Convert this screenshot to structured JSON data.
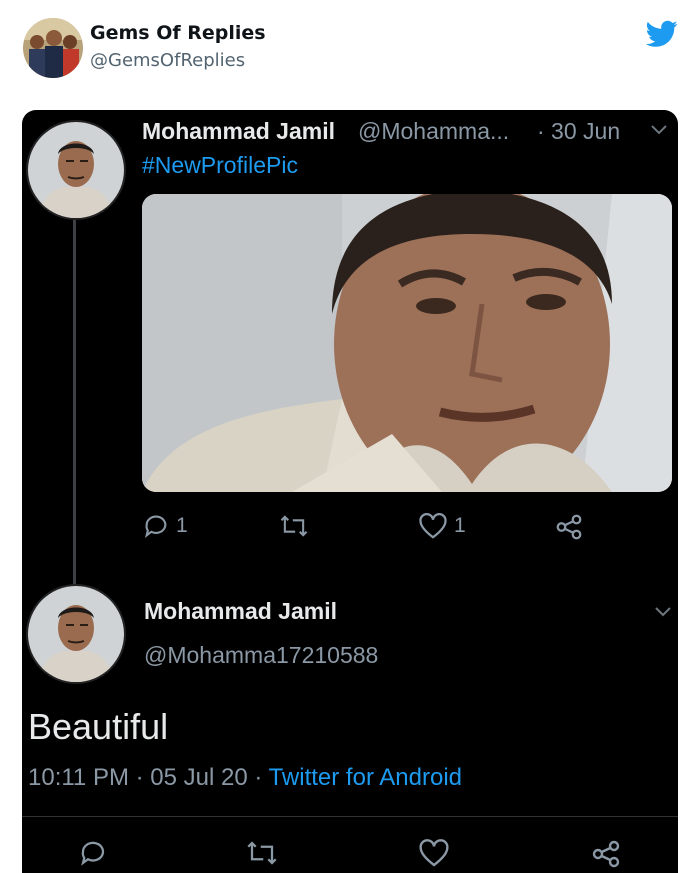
{
  "embed": {
    "name": "Gems Of Replies",
    "handle": "@GemsOfReplies",
    "icon": "twitter-bird-icon",
    "accent": "#1d9bf0"
  },
  "tweet": {
    "name": "Mohammad Jamil",
    "handle": "@Mohamma...",
    "date": "· 30 Jun",
    "hashtag": "#NewProfilePic",
    "replies": "1",
    "likes": "1"
  },
  "reply": {
    "name": "Mohammad Jamil",
    "handle": "@Mohamma17210588",
    "text": "Beautiful",
    "time": "10:11 PM · 05 Jul 20 ·",
    "source": "Twitter for Android"
  },
  "colors": {
    "background": "#000000",
    "text": "#e7e9ea",
    "secondary": "#8b98a5",
    "link": "#1d9bf0"
  }
}
